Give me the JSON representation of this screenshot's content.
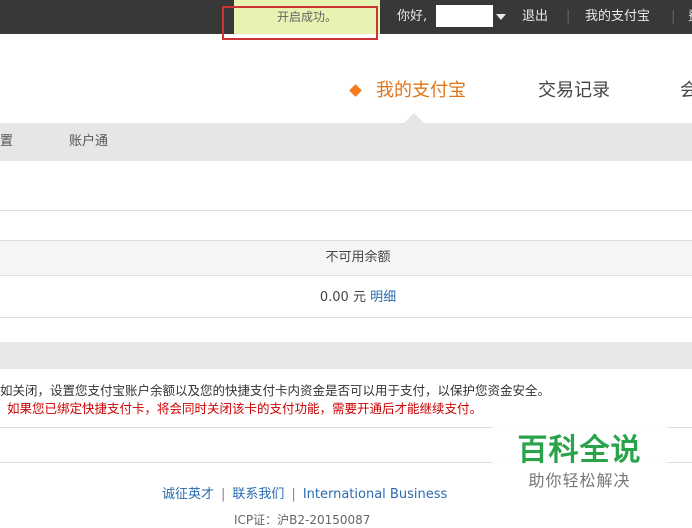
{
  "topbar": {
    "toast": "开启成功。",
    "greeting": "你好,",
    "logout": "退出",
    "separator": "|",
    "my_alipay": "我的支付宝",
    "more_partial": "费"
  },
  "nav": {
    "tabs": [
      {
        "label": "我的支付宝",
        "active": true
      },
      {
        "label": "交易记录",
        "active": false
      },
      {
        "label": "会",
        "active": false
      }
    ],
    "accent_color": "#f57c1f"
  },
  "subnav": {
    "items": [
      {
        "label": "置"
      },
      {
        "label": "账户通"
      }
    ]
  },
  "balance_table": {
    "column_header": "不可用余额",
    "amount": "0.00 元",
    "detail_link": "明细"
  },
  "notes": {
    "line1": "如关闭，设置您支付宝账户余额以及您的快捷支付卡内资金是否可以用于支付，以保护您资金安全。",
    "line2": "如果您已绑定快捷支付卡，将会同时关闭该卡的支付功能，需要开通后才能继续支付。"
  },
  "footer": {
    "links": [
      "诚征英才",
      "联系我们",
      "International Business"
    ],
    "separator": "|",
    "icp": "ICP证：沪B2-20150087"
  },
  "watermark": {
    "title": "百科全说",
    "subtitle": "助你轻松解决"
  }
}
